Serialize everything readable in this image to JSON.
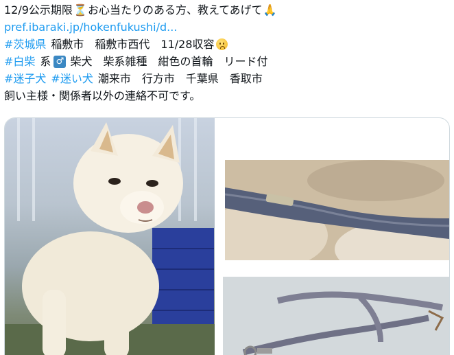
{
  "tweet": {
    "line1_a": "12/9公示期限",
    "line1_b": "お心当たりのある方、教えてあげて",
    "link": "pref.ibaraki.jp/hokenfukushi/d...",
    "line3_tag": "#茨城県",
    "line3_text": "稲敷市　稲敷市西代　11/28収容",
    "line4_tag": "#白柴",
    "line4_a": "系",
    "line4_male": "♂",
    "line4_b": "柴犬　柴系雑種　紺色の首輪　リード付",
    "line5_tag1": "#迷子犬",
    "line5_tag2": "#迷い犬",
    "line5_text": "潮来市　行方市　千葉県　香取市",
    "line6": "飼い主様・関係者以外の連絡不可です。"
  },
  "icons": {
    "hourglass": "hourglass-icon",
    "pray": "folded-hands-icon",
    "worried": "worried-face-icon",
    "male": "male-sign-icon"
  },
  "colors": {
    "text": "#0f1419",
    "link": "#1d9bf0",
    "male_box": "#3b88c3",
    "media_border": "#cfd9de"
  },
  "media": {
    "photos": [
      {
        "name": "white-shiba-dog-photo"
      },
      {
        "name": "navy-collar-closeup-photo"
      },
      {
        "name": "leash-photo"
      }
    ]
  }
}
